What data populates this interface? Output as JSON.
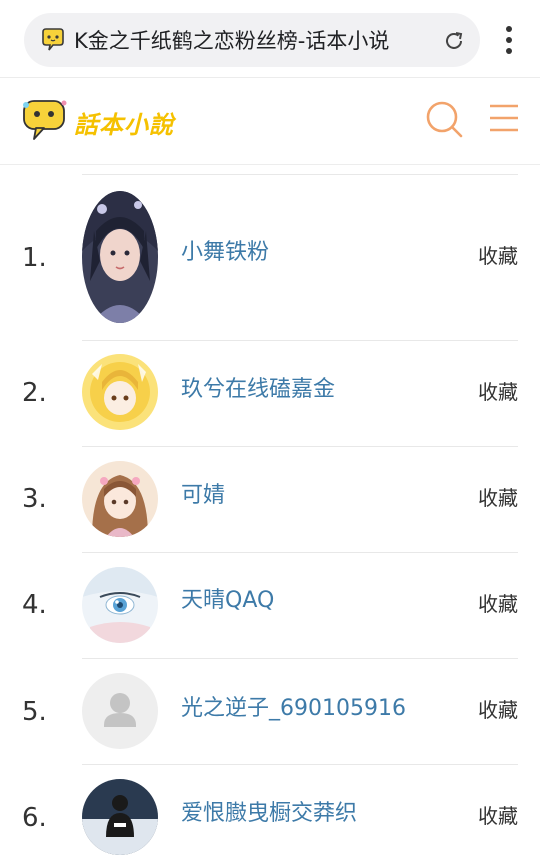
{
  "browser": {
    "url_title": "K金之千纸鹤之恋粉丝榜-话本小说",
    "favicon": "chat-bubble-icon",
    "reload_icon": "reload-icon",
    "more_icon": "more-vert-icon"
  },
  "header": {
    "logo_text": "話本小說",
    "search_icon": "search-icon",
    "menu_icon": "menu-icon",
    "accent_color": "#f2a36b",
    "logo_color": "#f5c100"
  },
  "rankings": [
    {
      "rank": "1.",
      "name": "小舞铁粉",
      "action": "收藏"
    },
    {
      "rank": "2.",
      "name": "玖兮在线磕嘉金",
      "action": "收藏"
    },
    {
      "rank": "3.",
      "name": "可婧",
      "action": "收藏"
    },
    {
      "rank": "4.",
      "name": "天晴QAQ",
      "action": "收藏"
    },
    {
      "rank": "5.",
      "name": "光之逆子_690105916",
      "action": "收藏"
    },
    {
      "rank": "6.",
      "name": "爱恨臌曳橱交莽织",
      "action": "收藏"
    }
  ],
  "colors": {
    "name_link": "#3d7aa8",
    "text": "#333333",
    "divider": "#e8e8e8"
  }
}
